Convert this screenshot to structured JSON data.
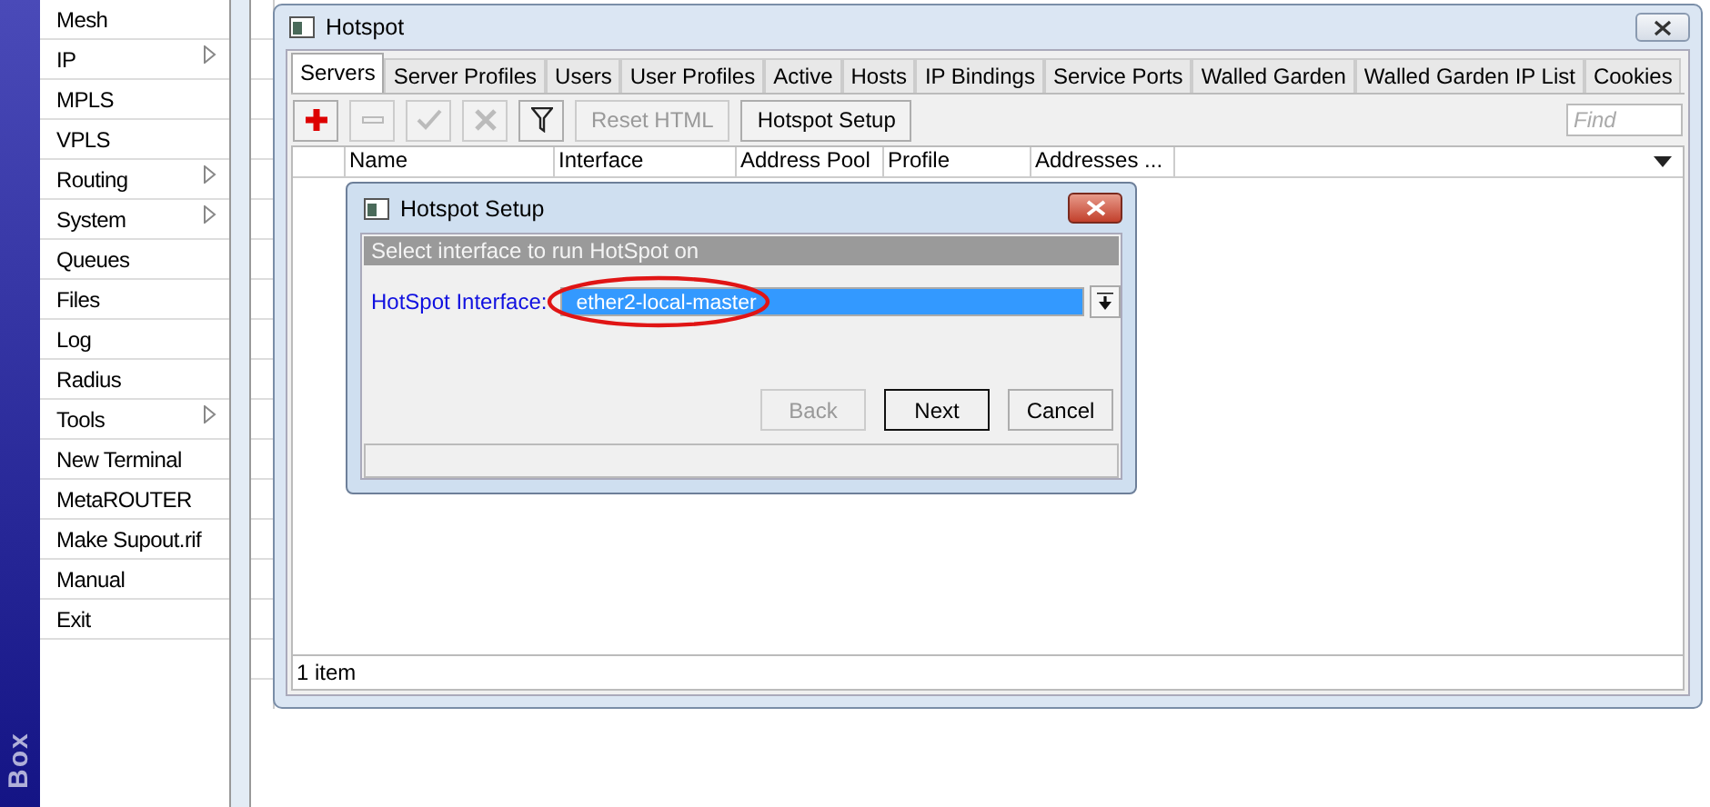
{
  "brand": {
    "text": "Box"
  },
  "menu": [
    {
      "label": "Mesh",
      "submenu": false
    },
    {
      "label": "IP",
      "submenu": true
    },
    {
      "label": "MPLS",
      "submenu": false
    },
    {
      "label": "VPLS",
      "submenu": false
    },
    {
      "label": "Routing",
      "submenu": true
    },
    {
      "label": "System",
      "submenu": true
    },
    {
      "label": "Queues",
      "submenu": false
    },
    {
      "label": "Files",
      "submenu": false
    },
    {
      "label": "Log",
      "submenu": false
    },
    {
      "label": "Radius",
      "submenu": false
    },
    {
      "label": "Tools",
      "submenu": true
    },
    {
      "label": "New Terminal",
      "submenu": false
    },
    {
      "label": "MetaROUTER",
      "submenu": false
    },
    {
      "label": "Make Supout.rif",
      "submenu": false
    },
    {
      "label": "Manual",
      "submenu": false
    },
    {
      "label": "Exit",
      "submenu": false
    }
  ],
  "window": {
    "title": "Hotspot",
    "tabs": [
      {
        "label": "Servers",
        "selected": true
      },
      {
        "label": "Server Profiles",
        "selected": false
      },
      {
        "label": "Users",
        "selected": false
      },
      {
        "label": "User Profiles",
        "selected": false
      },
      {
        "label": "Active",
        "selected": false
      },
      {
        "label": "Hosts",
        "selected": false
      },
      {
        "label": "IP Bindings",
        "selected": false
      },
      {
        "label": "Service Ports",
        "selected": false
      },
      {
        "label": "Walled Garden",
        "selected": false
      },
      {
        "label": "Walled Garden IP List",
        "selected": false
      },
      {
        "label": "Cookies",
        "selected": false
      }
    ],
    "toolbar": [
      {
        "kind": "add",
        "disabled": false
      },
      {
        "kind": "remove",
        "disabled": true
      },
      {
        "kind": "enable",
        "disabled": true
      },
      {
        "kind": "disable",
        "disabled": true
      },
      {
        "kind": "filter",
        "disabled": false
      },
      {
        "kind": "text",
        "label": "Reset HTML",
        "disabled": true
      },
      {
        "kind": "text",
        "label": "Hotspot Setup",
        "disabled": false
      }
    ],
    "search": {
      "placeholder": "Find"
    },
    "table": {
      "columns": [
        "Name",
        "Interface",
        "Address Pool",
        "Profile",
        "Addresses ..."
      ]
    },
    "status_bar": "1 item"
  },
  "dialog": {
    "title": "Hotspot Setup",
    "instruction": "Select interface to run HotSpot on",
    "field": {
      "label": "HotSpot Interface:",
      "value": "ether2-local-master"
    },
    "buttons": [
      {
        "label": "Back",
        "disabled": true,
        "default": false
      },
      {
        "label": "Next",
        "disabled": false,
        "default": true
      },
      {
        "label": "Cancel",
        "disabled": false,
        "default": false
      }
    ]
  }
}
